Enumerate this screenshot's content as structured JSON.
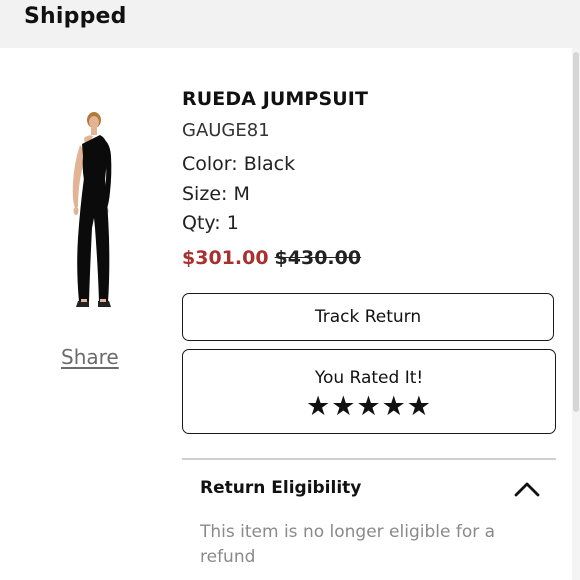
{
  "header": {
    "status": "Shipped"
  },
  "product": {
    "name": "RUEDA JUMPSUIT",
    "brand": "GAUGE81",
    "color_line": "Color: Black",
    "size_line": "Size: M",
    "qty_line": "Qty: 1",
    "sale_price": "$301.00",
    "original_price": "$430.00",
    "image_icon": "jumpsuit-product-image"
  },
  "share": {
    "label": "Share"
  },
  "actions": {
    "track_return_label": "Track Return"
  },
  "rating": {
    "label": "You Rated It!",
    "stars": "★★★★★",
    "value": 5,
    "max": 5
  },
  "eligibility": {
    "title": "Return Eligibility",
    "message": "This item is no longer eligible for a refund",
    "expanded": true,
    "toggle_icon": "chevron-up-icon"
  },
  "colors": {
    "sale_price": "#a8312f",
    "header_background": "#f2f2f2",
    "muted_text": "#8a8a8a"
  }
}
